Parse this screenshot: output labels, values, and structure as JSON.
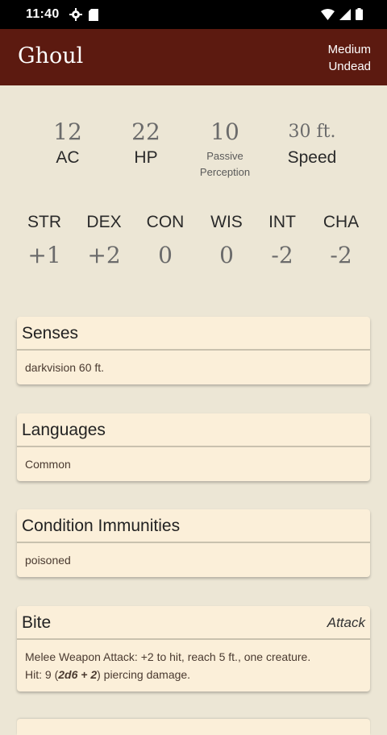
{
  "status": {
    "time": "11:40",
    "icons": [
      "gear-icon",
      "sd-card-icon",
      "wifi-icon",
      "signal-icon",
      "battery-icon"
    ]
  },
  "appbar": {
    "title": "Ghoul",
    "size": "Medium",
    "type": "Undead",
    "color": "#5c1a10"
  },
  "stats": {
    "ac": {
      "value": "12",
      "label": "AC"
    },
    "hp": {
      "value": "22",
      "label": "HP"
    },
    "passive": {
      "value": "10",
      "label_line1": "Passive",
      "label_line2": "Perception"
    },
    "speed": {
      "value": "30 ft.",
      "label": "Speed"
    }
  },
  "abilities": [
    {
      "name": "STR",
      "mod": "+1"
    },
    {
      "name": "DEX",
      "mod": "+2"
    },
    {
      "name": "CON",
      "mod": "0"
    },
    {
      "name": "WIS",
      "mod": "0"
    },
    {
      "name": "INT",
      "mod": "-2"
    },
    {
      "name": "CHA",
      "mod": "-2"
    }
  ],
  "cards": {
    "senses": {
      "title": "Senses",
      "body": "darkvision 60 ft."
    },
    "languages": {
      "title": "Languages",
      "body": "Common"
    },
    "conditions": {
      "title": "Condition Immunities",
      "body": "poisoned"
    },
    "bite": {
      "title": "Bite",
      "tag": "Attack",
      "line1": "Melee Weapon Attack: +2 to hit, reach 5 ft., one creature.",
      "hit_prefix": "Hit: 9 (",
      "dice": "2d6 + 2",
      "hit_suffix": ") piercing damage."
    }
  }
}
